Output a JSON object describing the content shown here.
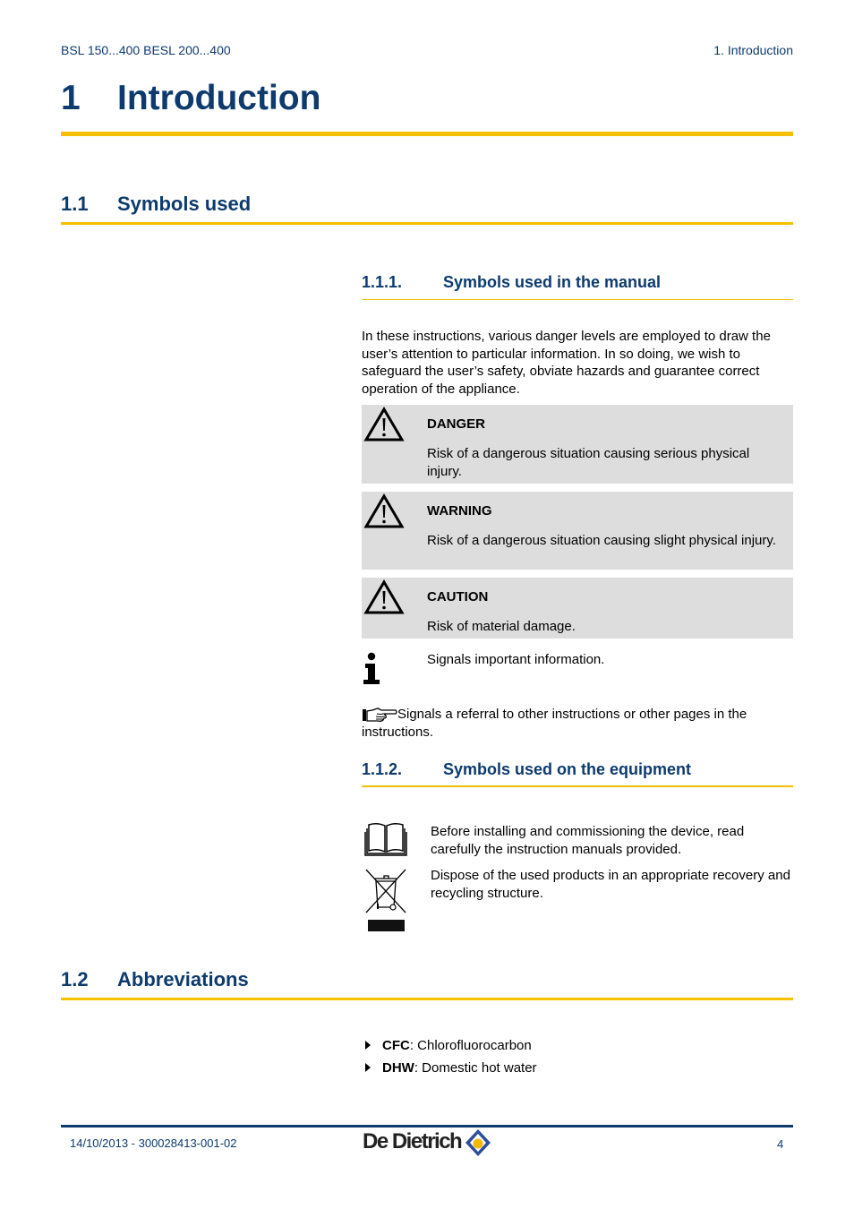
{
  "header": {
    "left": "BSL 150...400 BESL 200...400",
    "right": "1.  Introduction"
  },
  "chapter": {
    "number": "1",
    "title": "Introduction"
  },
  "section_1_1": {
    "number": "1.1",
    "title": "Symbols used"
  },
  "section_1_1_1": {
    "number": "1.1.1.",
    "title": "Symbols used in the manual",
    "intro": "In these instructions, various danger levels are employed to draw the user’s attention to particular information. In so doing, we wish to safeguard the user’s safety, obviate hazards and guarantee correct operation of the appliance.",
    "notices": [
      {
        "icon": "warning-triangle-icon",
        "title": "DANGER",
        "text": "Risk of a dangerous situation causing serious physical injury."
      },
      {
        "icon": "warning-triangle-icon",
        "title": "WARNING",
        "text": "Risk of a dangerous situation causing slight physical injury."
      },
      {
        "icon": "warning-triangle-icon",
        "title": "CAUTION",
        "text": "Risk of material damage."
      }
    ],
    "info": {
      "icon": "information-icon",
      "text": "Signals important information."
    },
    "referral": {
      "icon": "pointing-hand-icon",
      "text": "Signals a referral to other instructions or other pages in the instructions."
    }
  },
  "section_1_1_2": {
    "number": "1.1.2.",
    "title": "Symbols used on the equipment",
    "items": [
      {
        "icon": "open-book-icon",
        "text": "Before installing and commissioning the device, read carefully the instruction manuals provided."
      },
      {
        "icon": "crossed-bin-icon",
        "text": "Dispose of the used products in an appropriate recovery and recycling structure."
      }
    ]
  },
  "section_1_2": {
    "number": "1.2",
    "title": "Abbreviations",
    "items": [
      {
        "abbr": "CFC",
        "sep": ": ",
        "meaning": "Chlorofluorocarbon"
      },
      {
        "abbr": "DHW",
        "sep": ": ",
        "meaning": "Domestic hot water"
      }
    ]
  },
  "footer": {
    "doc_ref": "14/10/2013 - 300028413-001-02",
    "brand": "De Dietrich",
    "page": "4"
  },
  "colors": {
    "heading_blue": "#0d3b6e",
    "accent_yellow": "#f6c000",
    "notice_grey": "#dddddd",
    "logo_blue": "#2e4e9c",
    "logo_orange": "#f5b800"
  }
}
